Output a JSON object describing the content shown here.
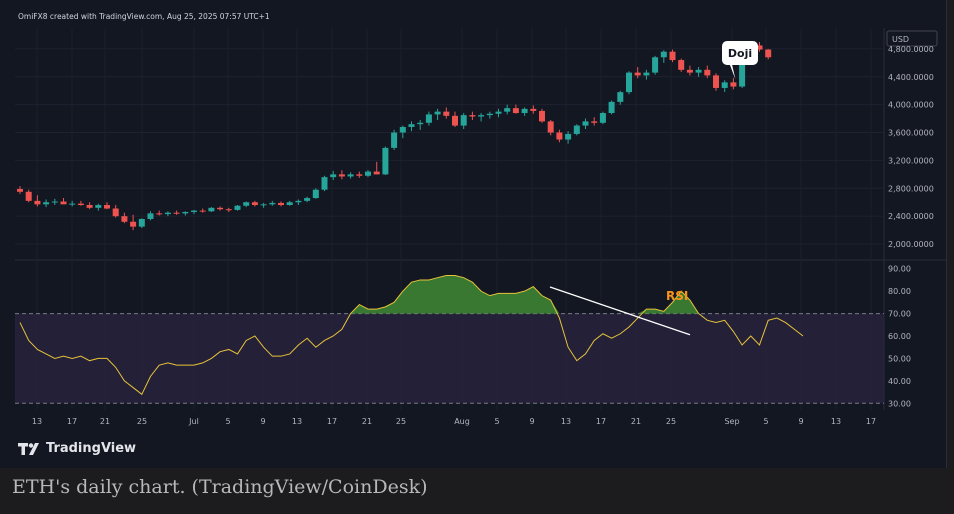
{
  "header": {
    "text": "OmiFX8 created with TradingView.com, Aug 25, 2025 07:57 UTC+1"
  },
  "brand": {
    "logo": "TV",
    "name": "TradingView"
  },
  "caption": {
    "text": "ETH's daily chart. (TradingView/CoinDesk)"
  },
  "colors": {
    "up": "#26a69a",
    "down": "#ef5350",
    "rsi_line": "#e8c33a",
    "rsi_band": "#2a2440",
    "overbought_fill": "#3f8a34",
    "background": "#131722"
  },
  "chart_data": [
    {
      "type": "candlestick",
      "currency_label": "USD",
      "price_ticks": [
        {
          "value": 4800,
          "label": "4,800.0000"
        },
        {
          "value": 4400,
          "label": "4,400.0000"
        },
        {
          "value": 4000,
          "label": "4,000.0000"
        },
        {
          "value": 3600,
          "label": "3,600.0000"
        },
        {
          "value": 3200,
          "label": "3,200.0000"
        },
        {
          "value": 2800,
          "label": "2,800.0000"
        },
        {
          "value": 2400,
          "label": "2,400.0000"
        },
        {
          "value": 2000,
          "label": "2,000.0000"
        }
      ],
      "ylim": [
        1800,
        5100
      ],
      "start_date": "2025-06-10",
      "candles": [
        [
          2790,
          2830,
          2720,
          2750
        ],
        [
          2750,
          2780,
          2600,
          2620
        ],
        [
          2620,
          2700,
          2540,
          2570
        ],
        [
          2570,
          2640,
          2530,
          2600
        ],
        [
          2600,
          2650,
          2560,
          2610
        ],
        [
          2610,
          2660,
          2580,
          2570
        ],
        [
          2570,
          2620,
          2540,
          2580
        ],
        [
          2580,
          2620,
          2550,
          2560
        ],
        [
          2560,
          2600,
          2500,
          2520
        ],
        [
          2520,
          2580,
          2480,
          2560
        ],
        [
          2560,
          2600,
          2500,
          2510
        ],
        [
          2510,
          2560,
          2380,
          2400
        ],
        [
          2400,
          2450,
          2300,
          2320
        ],
        [
          2320,
          2420,
          2200,
          2250
        ],
        [
          2250,
          2370,
          2230,
          2360
        ],
        [
          2360,
          2470,
          2340,
          2440
        ],
        [
          2440,
          2480,
          2410,
          2430
        ],
        [
          2430,
          2470,
          2400,
          2450
        ],
        [
          2450,
          2480,
          2420,
          2440
        ],
        [
          2440,
          2470,
          2410,
          2460
        ],
        [
          2460,
          2490,
          2430,
          2480
        ],
        [
          2480,
          2510,
          2450,
          2470
        ],
        [
          2470,
          2530,
          2460,
          2520
        ],
        [
          2520,
          2540,
          2480,
          2500
        ],
        [
          2500,
          2520,
          2460,
          2490
        ],
        [
          2490,
          2560,
          2480,
          2550
        ],
        [
          2550,
          2610,
          2530,
          2600
        ],
        [
          2600,
          2620,
          2540,
          2560
        ],
        [
          2560,
          2590,
          2520,
          2570
        ],
        [
          2570,
          2620,
          2550,
          2590
        ],
        [
          2590,
          2610,
          2540,
          2560
        ],
        [
          2560,
          2620,
          2550,
          2600
        ],
        [
          2600,
          2640,
          2560,
          2620
        ],
        [
          2620,
          2680,
          2600,
          2660
        ],
        [
          2660,
          2800,
          2650,
          2780
        ],
        [
          2780,
          2980,
          2760,
          2960
        ],
        [
          2960,
          3050,
          2920,
          3000
        ],
        [
          3000,
          3060,
          2930,
          2970
        ],
        [
          2970,
          3030,
          2940,
          3000
        ],
        [
          3000,
          3040,
          2950,
          2980
        ],
        [
          2980,
          3060,
          2960,
          3040
        ],
        [
          3040,
          3180,
          3000,
          3000
        ],
        [
          3000,
          3400,
          2990,
          3380
        ],
        [
          3380,
          3640,
          3350,
          3600
        ],
        [
          3600,
          3700,
          3520,
          3680
        ],
        [
          3680,
          3760,
          3620,
          3720
        ],
        [
          3720,
          3780,
          3640,
          3740
        ],
        [
          3740,
          3900,
          3700,
          3860
        ],
        [
          3860,
          3940,
          3780,
          3900
        ],
        [
          3900,
          3960,
          3800,
          3840
        ],
        [
          3840,
          3900,
          3680,
          3700
        ],
        [
          3700,
          3880,
          3650,
          3850
        ],
        [
          3850,
          3900,
          3780,
          3830
        ],
        [
          3830,
          3880,
          3760,
          3850
        ],
        [
          3850,
          3900,
          3800,
          3870
        ],
        [
          3870,
          3940,
          3820,
          3900
        ],
        [
          3900,
          4000,
          3860,
          3950
        ],
        [
          3950,
          4000,
          3870,
          3880
        ],
        [
          3880,
          3960,
          3840,
          3940
        ],
        [
          3940,
          3990,
          3870,
          3910
        ],
        [
          3910,
          3940,
          3740,
          3760
        ],
        [
          3760,
          3780,
          3560,
          3600
        ],
        [
          3600,
          3640,
          3460,
          3500
        ],
        [
          3500,
          3620,
          3440,
          3580
        ],
        [
          3580,
          3720,
          3560,
          3700
        ],
        [
          3700,
          3800,
          3650,
          3760
        ],
        [
          3760,
          3820,
          3700,
          3740
        ],
        [
          3740,
          3900,
          3720,
          3880
        ],
        [
          3880,
          4060,
          3860,
          4040
        ],
        [
          4040,
          4200,
          4000,
          4180
        ],
        [
          4180,
          4480,
          4150,
          4460
        ],
        [
          4460,
          4540,
          4380,
          4420
        ],
        [
          4420,
          4500,
          4360,
          4460
        ],
        [
          4460,
          4700,
          4430,
          4680
        ],
        [
          4680,
          4780,
          4600,
          4760
        ],
        [
          4760,
          4790,
          4610,
          4640
        ],
        [
          4640,
          4660,
          4470,
          4500
        ],
        [
          4500,
          4560,
          4420,
          4460
        ],
        [
          4460,
          4540,
          4400,
          4500
        ],
        [
          4500,
          4560,
          4380,
          4420
        ],
        [
          4420,
          4450,
          4200,
          4240
        ],
        [
          4240,
          4350,
          4180,
          4320
        ],
        [
          4320,
          4380,
          4220,
          4260
        ],
        [
          4260,
          4880,
          4240,
          4850
        ],
        [
          4850,
          4900,
          4800,
          4850
        ],
        [
          4850,
          4900,
          4760,
          4790
        ],
        [
          4790,
          4800,
          4650,
          4680
        ]
      ],
      "annotation": {
        "label": "Doji",
        "index": 82
      }
    },
    {
      "type": "line",
      "title": "RSI",
      "rsi_ticks": [
        90,
        80,
        70,
        60,
        50,
        40,
        30
      ],
      "tick_labels": [
        "90.00",
        "80.00",
        "70.00",
        "60.00",
        "50.00",
        "40.00",
        "30.00"
      ],
      "ylim": [
        27,
        93
      ],
      "bands": [
        30,
        70
      ],
      "values": [
        66,
        58,
        54,
        52,
        50,
        51,
        50,
        51,
        49,
        50,
        50,
        46,
        40,
        37,
        34,
        42,
        47,
        48,
        47,
        47,
        47,
        48,
        50,
        53,
        54,
        52,
        58,
        60,
        55,
        51,
        51,
        52,
        56,
        59,
        55,
        58,
        60,
        63,
        70,
        74,
        72,
        72,
        73,
        75,
        80,
        84,
        85,
        85,
        86,
        87,
        87,
        86,
        84,
        80,
        78,
        79,
        79,
        79,
        80,
        82,
        78,
        76,
        68,
        55,
        49,
        52,
        58,
        61,
        59,
        61,
        64,
        68,
        72,
        72,
        71,
        75,
        80,
        76,
        70,
        67,
        66,
        67,
        62,
        56,
        60,
        56,
        67,
        68,
        66,
        63,
        60
      ],
      "trendline": [
        [
          41,
          80.5
        ],
        [
          53,
          61
        ]
      ]
    }
  ],
  "x_axis": {
    "labels": [
      {
        "text": "13",
        "x": 37
      },
      {
        "text": "17",
        "x": 72
      },
      {
        "text": "21",
        "x": 105
      },
      {
        "text": "25",
        "x": 142
      },
      {
        "text": "Jul",
        "x": 194
      },
      {
        "text": "5",
        "x": 228
      },
      {
        "text": "9",
        "x": 263
      },
      {
        "text": "13",
        "x": 297
      },
      {
        "text": "17",
        "x": 332
      },
      {
        "text": "21",
        "x": 367
      },
      {
        "text": "25",
        "x": 401
      },
      {
        "text": "Aug",
        "x": 462
      },
      {
        "text": "5",
        "x": 497
      },
      {
        "text": "9",
        "x": 532
      },
      {
        "text": "13",
        "x": 566
      },
      {
        "text": "17",
        "x": 601
      },
      {
        "text": "21",
        "x": 636
      },
      {
        "text": "25",
        "x": 671
      },
      {
        "text": "Sep",
        "x": 732
      },
      {
        "text": "5",
        "x": 766
      },
      {
        "text": "9",
        "x": 801
      },
      {
        "text": "13",
        "x": 836
      },
      {
        "text": "17",
        "x": 871
      }
    ]
  }
}
